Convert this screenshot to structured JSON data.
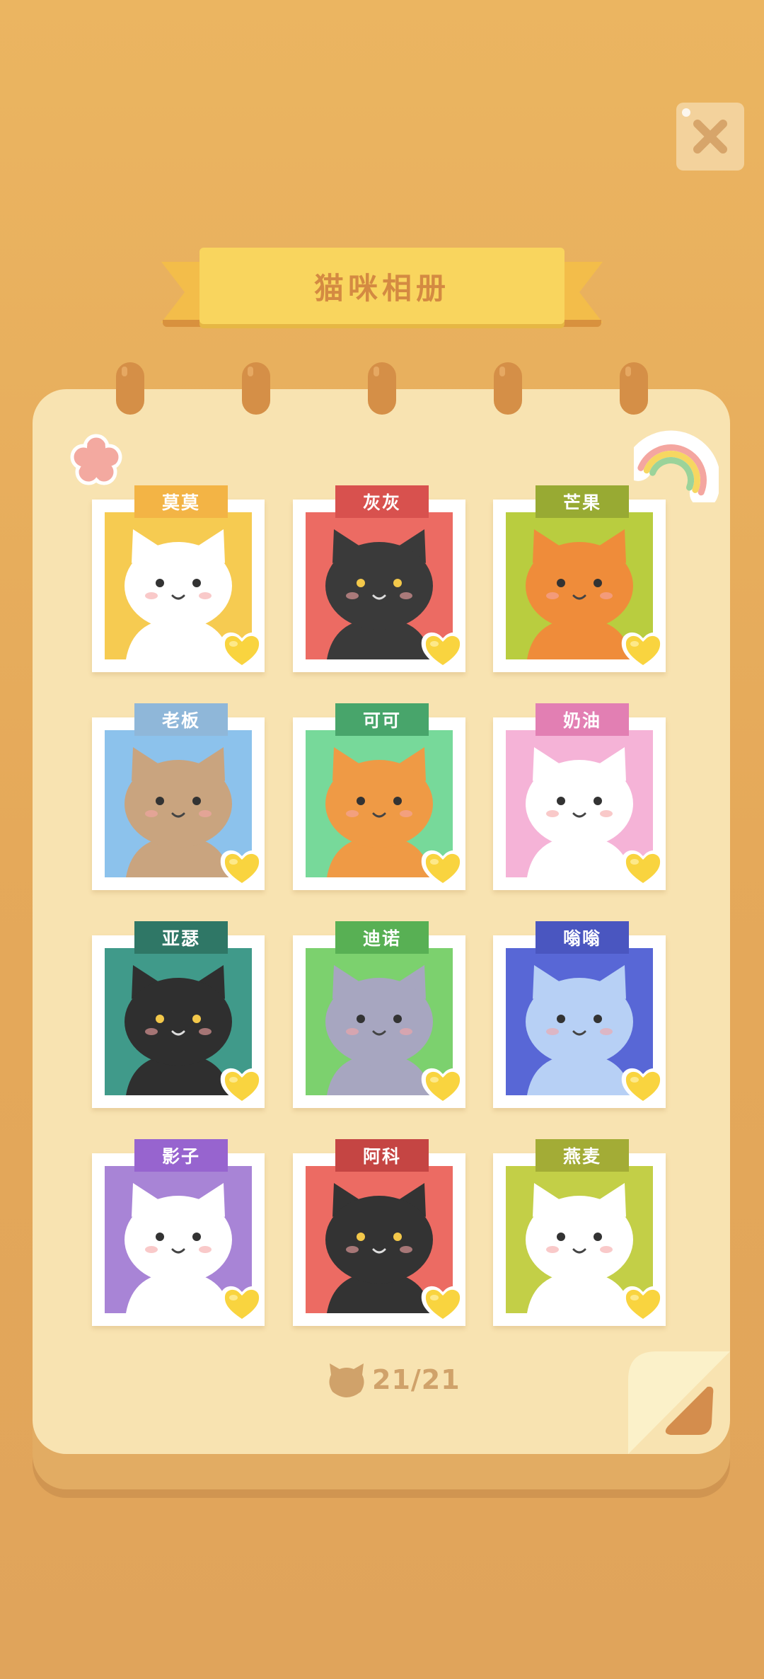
{
  "title": "猫咪相册",
  "progress": {
    "text": "21/21",
    "collected": 21,
    "total": 21
  },
  "cats": [
    {
      "name": "莫莫",
      "tag_color": "#f3b445",
      "bg": "#f6cb51",
      "fur": "#ffffff",
      "icon": "cat-momo"
    },
    {
      "name": "灰灰",
      "tag_color": "#d8514e",
      "bg": "#ec6b63",
      "fur": "#3a3a3a",
      "icon": "cat-huihui-headphones"
    },
    {
      "name": "芒果",
      "tag_color": "#98aa33",
      "bg": "#b9cd3f",
      "fur": "#ef8c3a",
      "icon": "cat-mango-glasses"
    },
    {
      "name": "老板",
      "tag_color": "#8fb7d9",
      "bg": "#8cc2ec",
      "fur": "#c9a47f",
      "icon": "cat-boss-tie"
    },
    {
      "name": "可可",
      "tag_color": "#48a56b",
      "bg": "#77d99a",
      "fur": "#ef9a45",
      "icon": "cat-coco-sunhat"
    },
    {
      "name": "奶油",
      "tag_color": "#e27fb3",
      "bg": "#f5b3d7",
      "fur": "#ffffff",
      "icon": "cat-cream-unicorn"
    },
    {
      "name": "亚瑟",
      "tag_color": "#2f7766",
      "bg": "#409a8a",
      "fur": "#2f2f2f",
      "icon": "cat-arthur-monocle"
    },
    {
      "name": "迪诺",
      "tag_color": "#58b054",
      "bg": "#7cd16e",
      "fur": "#a7a6c0",
      "icon": "cat-dino-costume"
    },
    {
      "name": "嗡嗡",
      "tag_color": "#4a56c0",
      "bg": "#5867d6",
      "fur": "#b7d0f5",
      "icon": "cat-astronaut"
    },
    {
      "name": "影子",
      "tag_color": "#9764cf",
      "bg": "#a884d6",
      "fur": "#ffffff",
      "icon": "cat-wizard"
    },
    {
      "name": "阿科",
      "tag_color": "#c54543",
      "bg": "#ec6b63",
      "fur": "#333333",
      "icon": "cat-artist-beret"
    },
    {
      "name": "燕麦",
      "tag_color": "#a3ac36",
      "bg": "#c3cf47",
      "fur": "#ffffff",
      "icon": "cat-oat-strawhat"
    }
  ]
}
